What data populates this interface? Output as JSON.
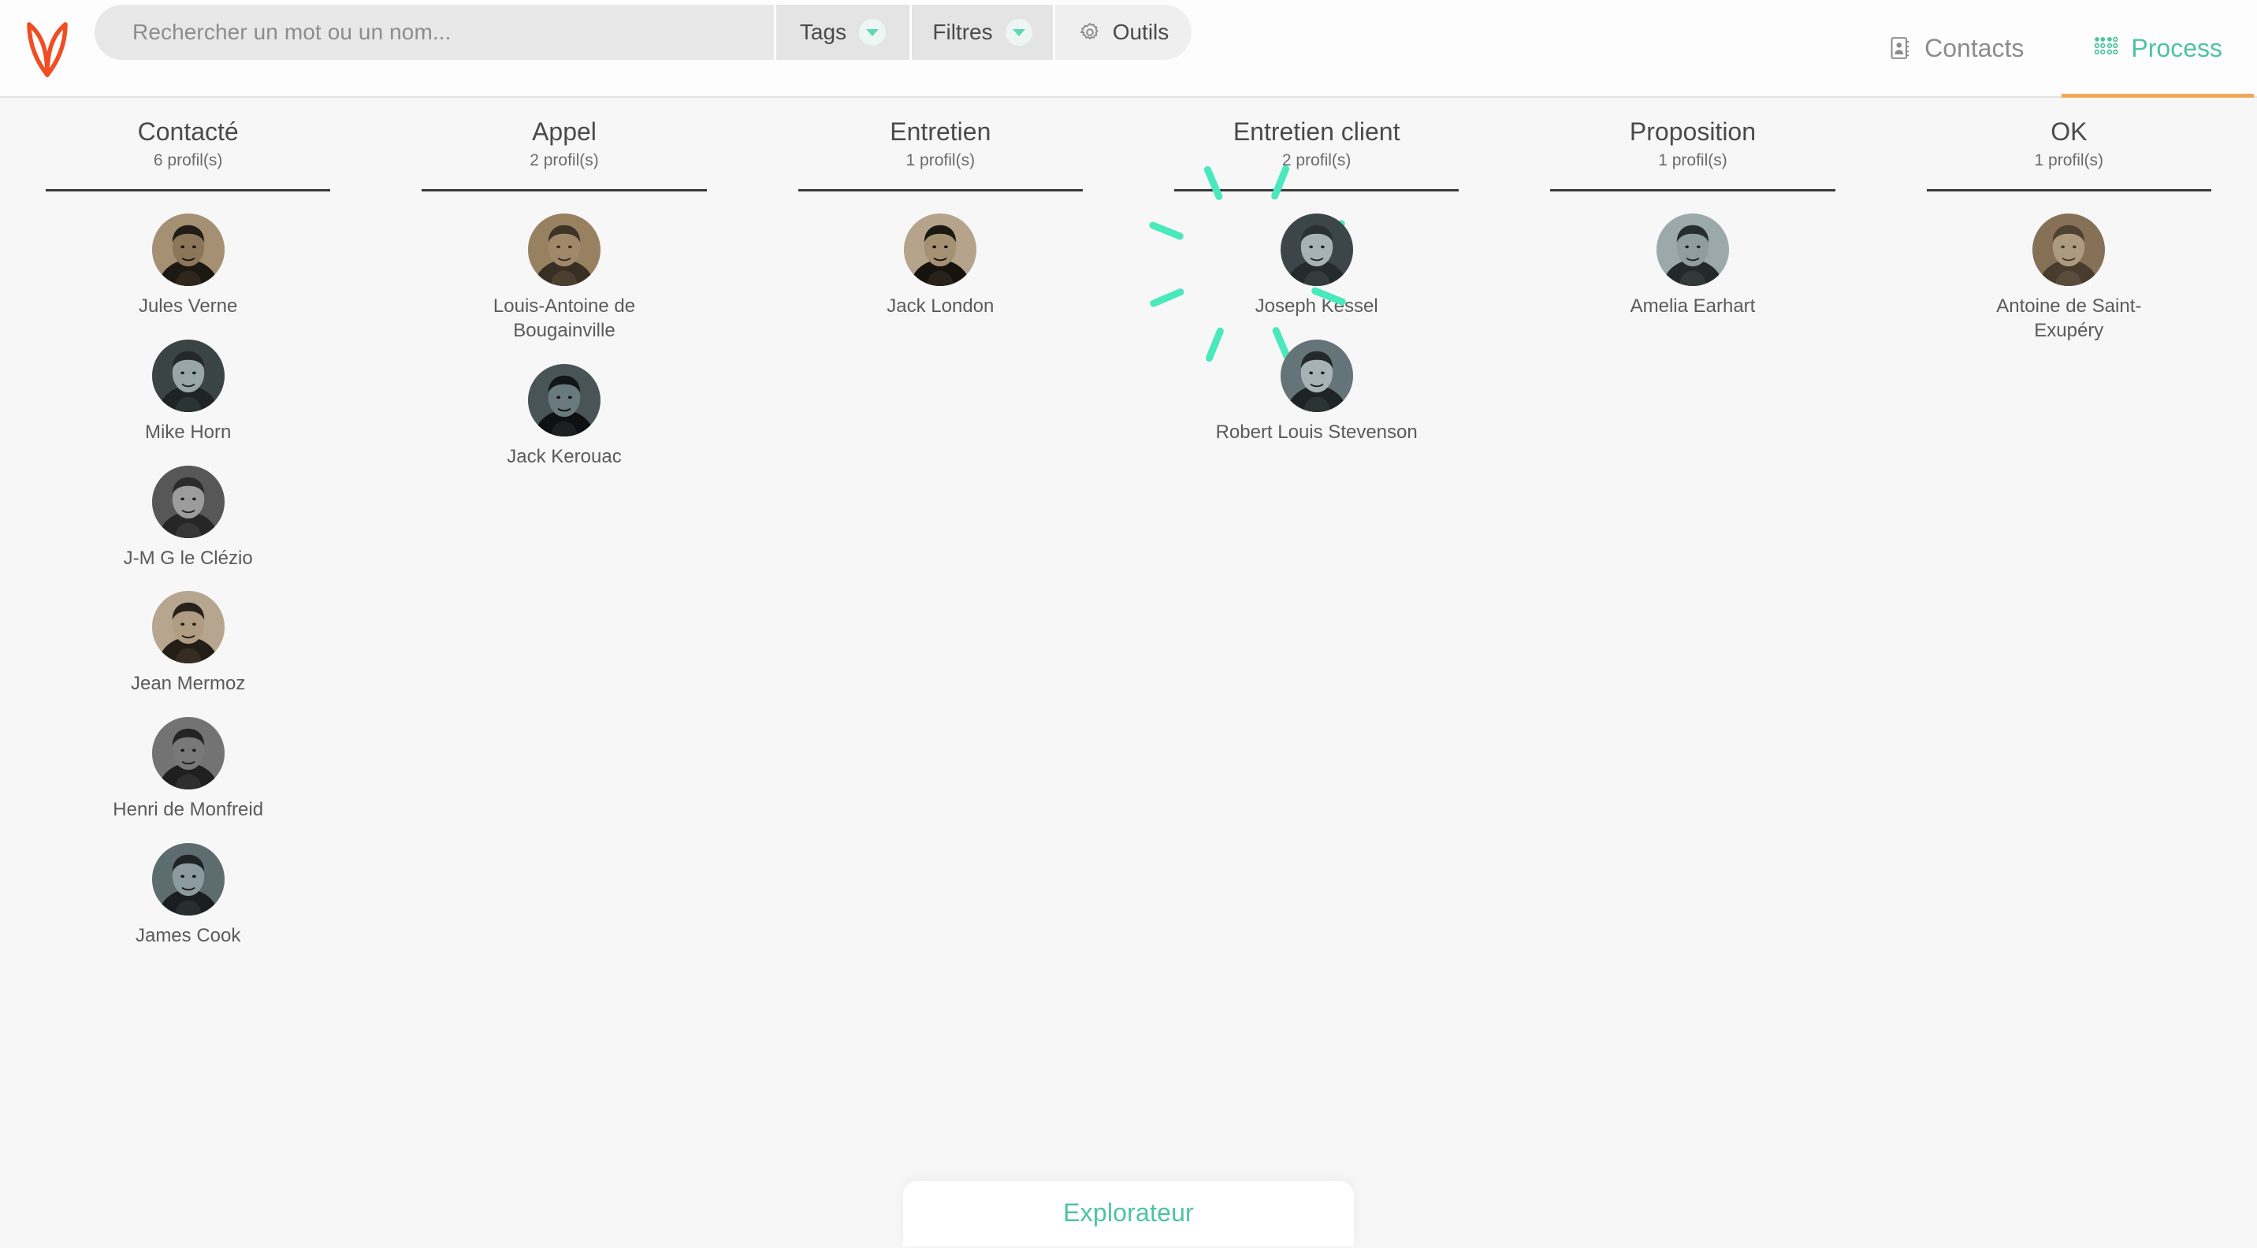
{
  "app": {
    "logo_name": "fox-logo",
    "logo_color": "#f04d23",
    "accent_teal": "#4dc4a1",
    "accent_orange": "#efa857",
    "highlight_teal": "#49e8bd"
  },
  "search": {
    "placeholder": "Rechercher un mot ou un nom...",
    "value": ""
  },
  "toolbar": {
    "tags_label": "Tags",
    "filtres_label": "Filtres",
    "outils_label": "Outils"
  },
  "nav": {
    "contacts_label": "Contacts",
    "process_label": "Process",
    "active": "Process"
  },
  "bottom": {
    "explorer_label": "Explorateur"
  },
  "board": {
    "columns": [
      {
        "title": "Contacté",
        "count": "6 profil(s)",
        "cards": [
          {
            "name": "Jules Verne"
          },
          {
            "name": "Mike Horn"
          },
          {
            "name": "J-M G le Clézio"
          },
          {
            "name": "Jean Mermoz"
          },
          {
            "name": "Henri de Monfreid"
          },
          {
            "name": "James Cook"
          }
        ]
      },
      {
        "title": "Appel",
        "count": "2 profil(s)",
        "cards": [
          {
            "name": "Louis-Antoine de Bougainville"
          },
          {
            "name": "Jack Kerouac"
          }
        ]
      },
      {
        "title": "Entretien",
        "count": "1 profil(s)",
        "cards": [
          {
            "name": "Jack London"
          }
        ]
      },
      {
        "title": "Entretien client",
        "count": "2 profil(s)",
        "cards": [
          {
            "name": "Joseph Kessel",
            "highlighted": true
          },
          {
            "name": "Robert Louis Stevenson"
          }
        ]
      },
      {
        "title": "Proposition",
        "count": "1 profil(s)",
        "cards": [
          {
            "name": "Amelia Earhart"
          }
        ]
      },
      {
        "title": "OK",
        "count": "1 profil(s)",
        "cards": [
          {
            "name": "Antoine de Saint-Exupéry"
          }
        ]
      }
    ]
  }
}
